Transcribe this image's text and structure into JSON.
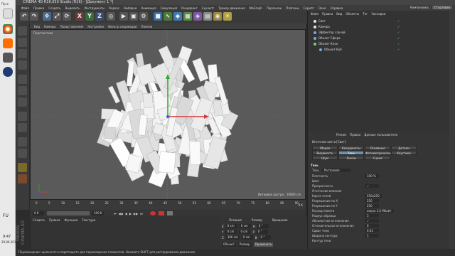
{
  "window": {
    "title": "CINEMA 4D R16.050 Studio (R16) - [Документ 1 *]"
  },
  "os": {
    "label": "Пуск",
    "lang": "FU",
    "time": "9:47",
    "date": "29.09.2016"
  },
  "menu": {
    "items": [
      "Файл",
      "Правка",
      "Создать",
      "Выделить",
      "Инструменты",
      "Каркас",
      "Выборки",
      "Анимация",
      "Симуляция",
      "Рендеринг",
      "Скульпт",
      "Трекер движения",
      "MoGraph",
      "Персонаж",
      "Плагины",
      "Скрипт",
      "Окно",
      "Справка"
    ],
    "layout_label": "Компоновка:",
    "layout_value": "Стартовая"
  },
  "toolbar": {
    "axis_x": "X",
    "axis_y": "Y",
    "axis_z": "Z"
  },
  "viewport": {
    "menu": [
      "Вид",
      "Камеры",
      "Представление",
      "Настройки",
      "Фильтр индикации",
      "Панели"
    ],
    "title": "Перспектива",
    "stats": "Интервал растра : 10000 cm"
  },
  "timeline": {
    "ticks": [
      "0",
      "5",
      "10",
      "15",
      "20",
      "25",
      "30",
      "35",
      "40",
      "45",
      "50",
      "55",
      "60",
      "65",
      "70",
      "75",
      "80",
      "85",
      "90"
    ],
    "frame_current": "0 K"
  },
  "transport": {
    "start": "0 K",
    "end": "100 K",
    "min": "0 K",
    "max": "100 K"
  },
  "material_manager": {
    "vtab": "MAXON CINEMA 4D",
    "menu": [
      "Создать",
      "Правка",
      "Функция",
      "Текстура"
    ]
  },
  "coords": {
    "headers": [
      "Позиция",
      "Размер",
      "Вращение"
    ],
    "rows": [
      {
        "axis": "X",
        "pos": "0 cm",
        "size": "0 cm",
        "rot_label": "H",
        "rot": "0 °"
      },
      {
        "axis": "Y",
        "pos": "0 cm",
        "size": "0 cm",
        "rot_label": "P",
        "rot": "0 °"
      },
      {
        "axis": "Z",
        "pos": "306 cm",
        "size": "0 cm",
        "rot_label": "B",
        "rot": "0 °"
      }
    ],
    "mode_object": "Объект",
    "mode_size": "Размер",
    "apply": "Применить"
  },
  "object_manager": {
    "menu": [
      "Файл",
      "Правка",
      "Вид",
      "Объекты",
      "Тег",
      "Закладки"
    ],
    "objects": [
      {
        "name": "Свет",
        "color": "#e8e8e8",
        "indent": 0
      },
      {
        "name": "Камера",
        "color": "#e8e8e8",
        "indent": 0
      },
      {
        "name": "Эффектор случай",
        "color": "#7aa7e6",
        "indent": 0
      },
      {
        "name": "Объект Сфера",
        "color": "#7aa7e6",
        "indent": 0
      },
      {
        "name": "Объект Клон",
        "color": "#7ad26f",
        "indent": 0
      },
      {
        "name": "Объект-Куб",
        "color": "#7aa7e6",
        "indent": 1
      }
    ]
  },
  "attribute_manager": {
    "menu": [
      "Режим",
      "Правка",
      "Данные пользователя"
    ],
    "title": "Источник света [Свет]",
    "tabs_row1": [
      "Общее",
      "Координаты",
      "Основные",
      "Детали"
    ],
    "tabs_row2": [
      "Видимость",
      "Тень",
      "Фотометрический",
      "Каустика"
    ],
    "tabs_row3": [
      "Шум",
      "Линзы",
      "Сцена"
    ],
    "active_tab": "Тень",
    "section": "Тень",
    "shadow_label": "Тень",
    "shadow_value": "Растровая",
    "rows": [
      {
        "label": "Плотность",
        "value": "100 %"
      },
      {
        "label": "Цвет",
        "value": ""
      },
      {
        "label": "Прозрачность",
        "value": "✓"
      },
      {
        "label": "Отсечение влияния",
        "value": ""
      },
      {
        "label": "Карта теней",
        "value": "250x250"
      },
      {
        "label": "Разрешение по Х",
        "value": "250"
      },
      {
        "label": "Разрешение по Y",
        "value": "250"
      },
      {
        "label": "Расход памяти",
        "value": "около 1.6 Мбайт"
      },
      {
        "label": "Радиус образца",
        "value": "3"
      },
      {
        "label": "Абсолютное отклонение",
        "value": "✓"
      },
      {
        "label": "Относительное отклонение",
        "value": "0"
      },
      {
        "label": "Сдвиг тени",
        "value": "0.01"
      },
      {
        "label": "Ширина контура",
        "value": "1"
      },
      {
        "label": "Контур тени",
        "value": ""
      }
    ]
  },
  "status": {
    "text": "Перемещение: щелкните и перетащите для перемещения элементов. Нажмите SHIFT для растрирования движения."
  }
}
